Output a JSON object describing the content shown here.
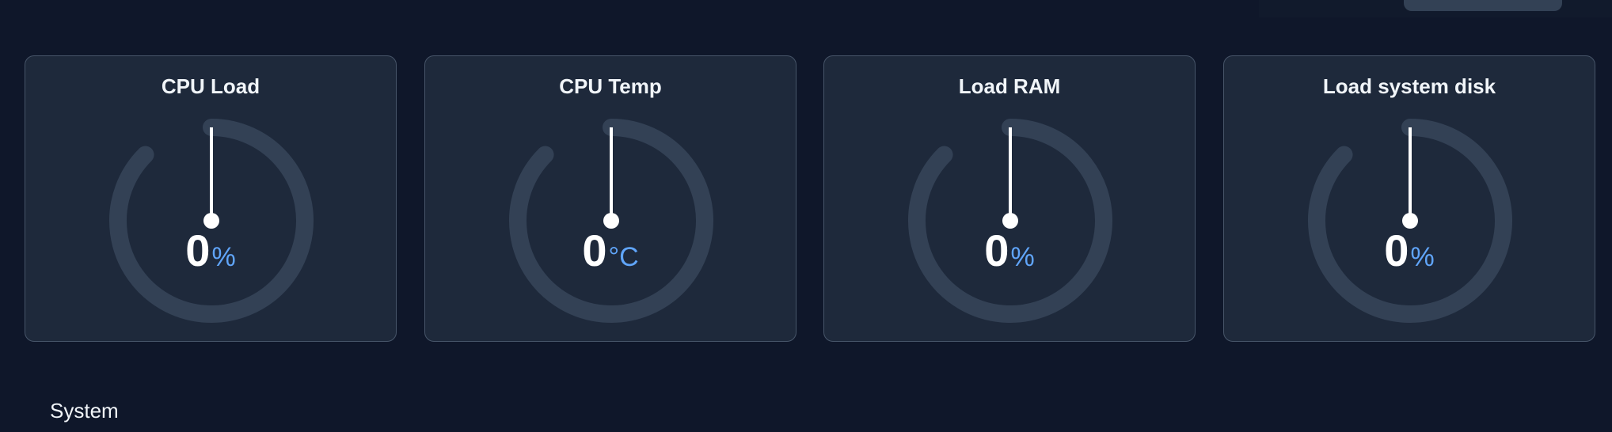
{
  "colors": {
    "background": "#0f172a",
    "card": "#1e293b",
    "card_border": "#475569",
    "gauge_track": "#334155",
    "needle": "#ffffff",
    "unit_accent": "#60a5fa"
  },
  "gauges": [
    {
      "title": "CPU Load",
      "value": "0",
      "unit": "%",
      "level": 0
    },
    {
      "title": "CPU Temp",
      "value": "0",
      "unit": "°C",
      "level": 0
    },
    {
      "title": "Load RAM",
      "value": "0",
      "unit": "%",
      "level": 0
    },
    {
      "title": "Load system disk",
      "value": "0",
      "unit": "%",
      "level": 0
    }
  ],
  "sections": {
    "system_title": "System"
  }
}
